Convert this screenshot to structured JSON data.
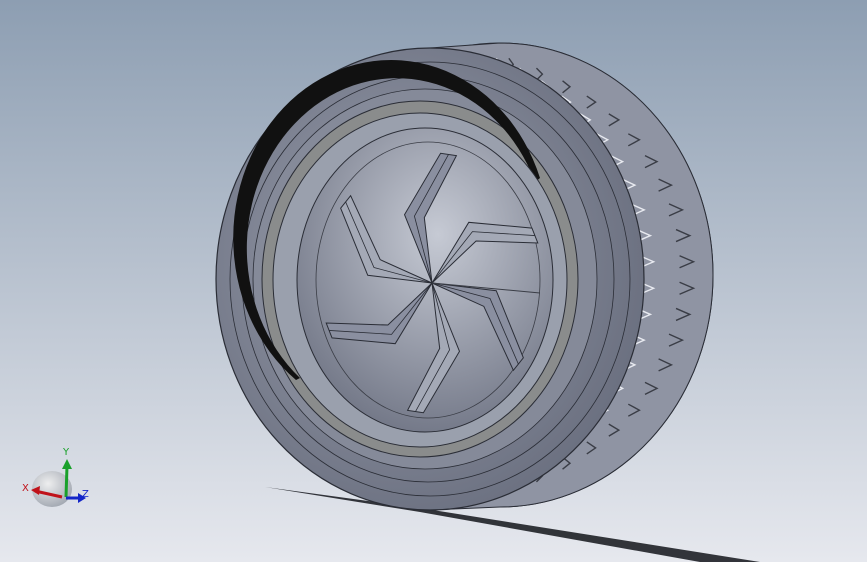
{
  "viewport": {
    "background_top": "#8d9eb2",
    "background_bottom": "#e6e8ee",
    "model": {
      "name": "wheel",
      "tire_color": "#7f8496",
      "tire_dark": "#5c6070",
      "rim_color": "#8a8fa0",
      "edge_color": "#2a2d36",
      "rim_band_dark": "#111111",
      "rim_band_light": "#8a8c8c",
      "spoke_count": 6
    }
  },
  "triad": {
    "x_label": "X",
    "y_label": "Y",
    "z_label": "Z",
    "x_color": "#c0121a",
    "y_color": "#19a02a",
    "z_color": "#1426c8"
  }
}
